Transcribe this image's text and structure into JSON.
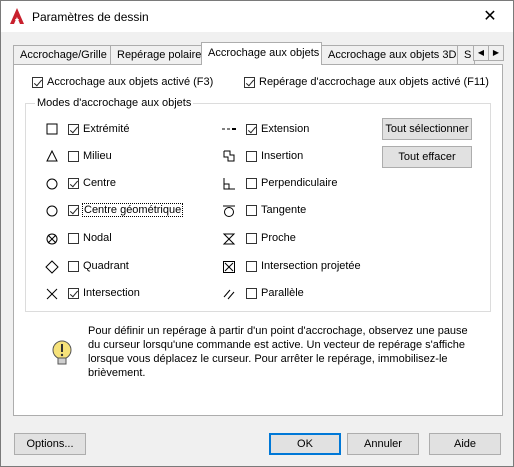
{
  "window": {
    "title": "Paramètres de dessin"
  },
  "tabs": [
    {
      "label": "Accrochage/Grille"
    },
    {
      "label": "Repérage polaire"
    },
    {
      "label": "Accrochage aux objets"
    },
    {
      "label": "Accrochage aux objets 3D"
    },
    {
      "label": "S"
    }
  ],
  "toggles": {
    "osnap_on": {
      "label": "Accrochage aux objets activé (F3)",
      "checked": true
    },
    "tracking_on": {
      "label": "Repérage d'accrochage aux objets activé (F11)",
      "checked": true
    }
  },
  "modes_title": "Modes d'accrochage aux objets",
  "left_modes": [
    {
      "label": "Extrémité",
      "checked": true,
      "icon": "square-icon"
    },
    {
      "label": "Milieu",
      "checked": false,
      "icon": "triangle-icon"
    },
    {
      "label": "Centre",
      "checked": true,
      "icon": "circle-icon"
    },
    {
      "label": "Centre géométrique",
      "checked": true,
      "icon": "circle-icon"
    },
    {
      "label": "Nodal",
      "checked": false,
      "icon": "circle-x-icon"
    },
    {
      "label": "Quadrant",
      "checked": false,
      "icon": "diamond-icon"
    },
    {
      "label": "Intersection",
      "checked": true,
      "icon": "x-icon"
    }
  ],
  "right_modes": [
    {
      "label": "Extension",
      "checked": true,
      "icon": "extension-icon"
    },
    {
      "label": "Insertion",
      "checked": false,
      "icon": "insertion-icon"
    },
    {
      "label": "Perpendiculaire",
      "checked": false,
      "icon": "perpendicular-icon"
    },
    {
      "label": "Tangente",
      "checked": false,
      "icon": "tangent-icon"
    },
    {
      "label": "Proche",
      "checked": false,
      "icon": "hourglass-icon"
    },
    {
      "label": "Intersection projetée",
      "checked": false,
      "icon": "square-x-icon"
    },
    {
      "label": "Parallèle",
      "checked": false,
      "icon": "parallel-icon"
    }
  ],
  "buttons": {
    "select_all": "Tout sélectionner",
    "clear_all": "Tout effacer",
    "options": "Options...",
    "ok": "OK",
    "cancel": "Annuler",
    "help": "Aide"
  },
  "info": "Pour définir un repérage à partir d'un point d'accrochage, observez une pause du curseur lorsqu'une commande est active. Un vecteur de repérage s'affiche lorsque vous déplacez le curseur. Pour arrêter le repérage, immobilisez-le brièvement."
}
